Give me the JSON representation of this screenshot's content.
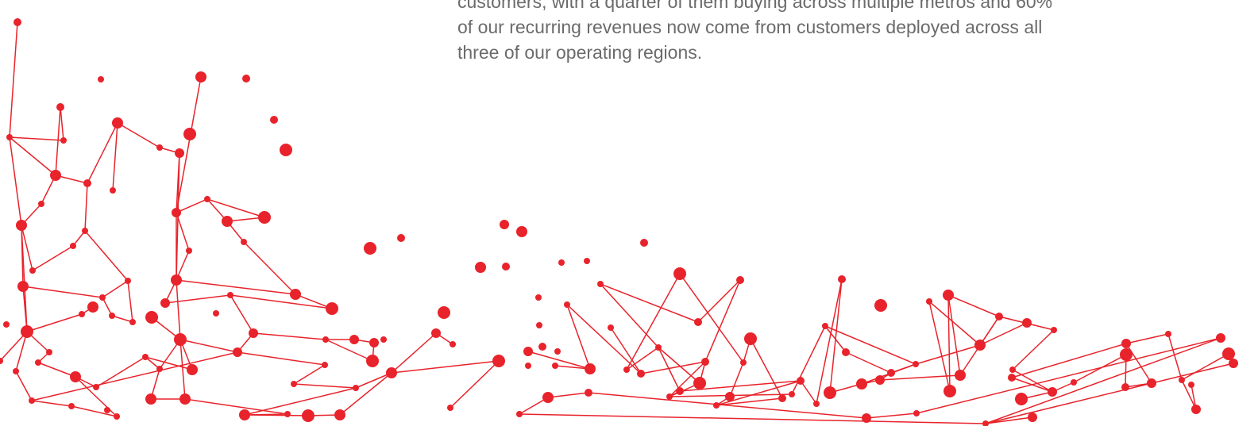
{
  "paragraph": {
    "lines": [
      "customers, with a quarter of them buying across multiple metros and 60%",
      "of our recurring revenues now come from customers deployed across all",
      "three of our operating regions."
    ]
  },
  "network": {
    "color": "#e8232b"
  }
}
